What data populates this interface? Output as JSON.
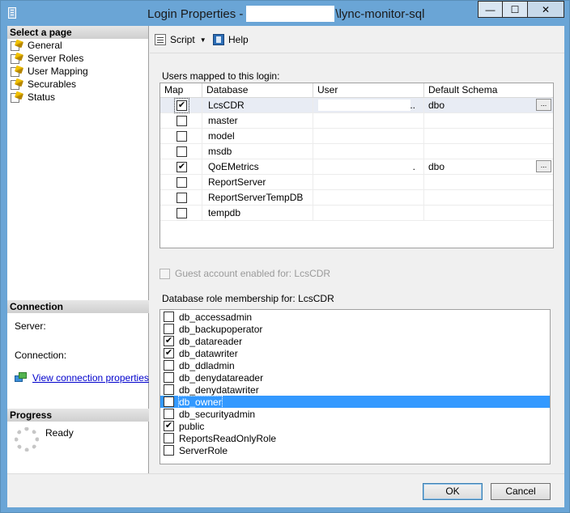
{
  "window": {
    "title_prefix": "Login Properties -",
    "title_suffix": "\\lync-monitor-sql",
    "minimize": "—",
    "maximize": "☐",
    "close": "✕"
  },
  "left": {
    "select_page_header": "Select a page",
    "pages": [
      {
        "label": "General"
      },
      {
        "label": "Server Roles"
      },
      {
        "label": "User Mapping"
      },
      {
        "label": "Securables"
      },
      {
        "label": "Status"
      }
    ],
    "connection_header": "Connection",
    "server_label": "Server:",
    "connection_label": "Connection:",
    "view_props_link": "View connection properties",
    "progress_header": "Progress",
    "progress_status": "Ready"
  },
  "toolbar": {
    "script_label": "Script",
    "help_label": "Help"
  },
  "users": {
    "label": "Users mapped to this login:",
    "columns": {
      "map": "Map",
      "database": "Database",
      "user": "User",
      "schema": "Default Schema"
    },
    "rows": [
      {
        "checked": true,
        "database": "LcsCDR",
        "user": "..",
        "schema": "dbo",
        "button": "..."
      },
      {
        "checked": false,
        "database": "master",
        "user": "",
        "schema": "",
        "button": ""
      },
      {
        "checked": false,
        "database": "model",
        "user": "",
        "schema": "",
        "button": ""
      },
      {
        "checked": false,
        "database": "msdb",
        "user": "",
        "schema": "",
        "button": ""
      },
      {
        "checked": true,
        "database": "QoEMetrics",
        "user": ".",
        "schema": "dbo",
        "button": "..."
      },
      {
        "checked": false,
        "database": "ReportServer",
        "user": "",
        "schema": "",
        "button": ""
      },
      {
        "checked": false,
        "database": "ReportServerTempDB",
        "user": "",
        "schema": "",
        "button": ""
      },
      {
        "checked": false,
        "database": "tempdb",
        "user": "",
        "schema": "",
        "button": ""
      }
    ]
  },
  "guest": {
    "label": "Guest account enabled for: LcsCDR",
    "checked": false
  },
  "roles": {
    "label": "Database role membership for: LcsCDR",
    "items": [
      {
        "label": "db_accessadmin",
        "checked": false
      },
      {
        "label": "db_backupoperator",
        "checked": false
      },
      {
        "label": "db_datareader",
        "checked": true
      },
      {
        "label": "db_datawriter",
        "checked": true
      },
      {
        "label": "db_ddladmin",
        "checked": false
      },
      {
        "label": "db_denydatareader",
        "checked": false
      },
      {
        "label": "db_denydatawriter",
        "checked": false
      },
      {
        "label": "db_owner",
        "checked": true
      },
      {
        "label": "db_securityadmin",
        "checked": false
      },
      {
        "label": "public",
        "checked": true
      },
      {
        "label": "ReportsReadOnlyRole",
        "checked": false
      },
      {
        "label": "ServerRole",
        "checked": false
      }
    ]
  },
  "buttons": {
    "ok": "OK",
    "cancel": "Cancel"
  }
}
